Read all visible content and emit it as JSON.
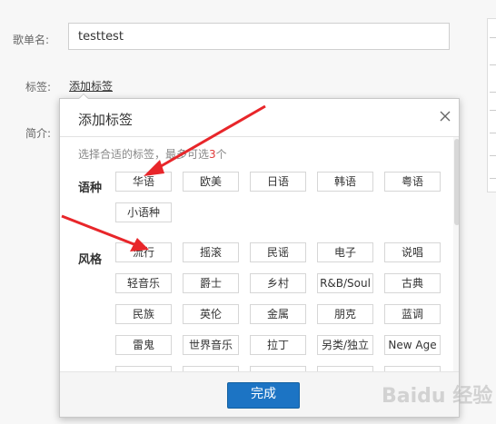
{
  "form": {
    "name_label": "歌单名:",
    "name_value": "testtest",
    "tags_label": "标签:",
    "add_tag_link": "添加标签",
    "intro_label": "简介:"
  },
  "dialog": {
    "title": "添加标签",
    "hint_prefix": "选择合适的标签，最多可选",
    "hint_number": "3",
    "hint_suffix": "个",
    "groups": [
      {
        "label": "语种",
        "tags": [
          "华语",
          "欧美",
          "日语",
          "韩语",
          "粤语",
          "小语种"
        ]
      },
      {
        "label": "风格",
        "tags": [
          "流行",
          "摇滚",
          "民谣",
          "电子",
          "说唱",
          "轻音乐",
          "爵士",
          "乡村",
          "R&B/Soul",
          "古典",
          "民族",
          "英伦",
          "金属",
          "朋克",
          "蓝调",
          "雷鬼",
          "世界音乐",
          "拉丁",
          "另类/独立",
          "New Age"
        ]
      }
    ],
    "confirm_label": "完成"
  },
  "icons": {
    "close": "close-icon",
    "annotation": "red-arrow"
  },
  "colors": {
    "accent": "#1c74c4",
    "annotation": "#e8262a",
    "hint_number": "#e03a3a"
  },
  "watermark": "Baidu 经验"
}
